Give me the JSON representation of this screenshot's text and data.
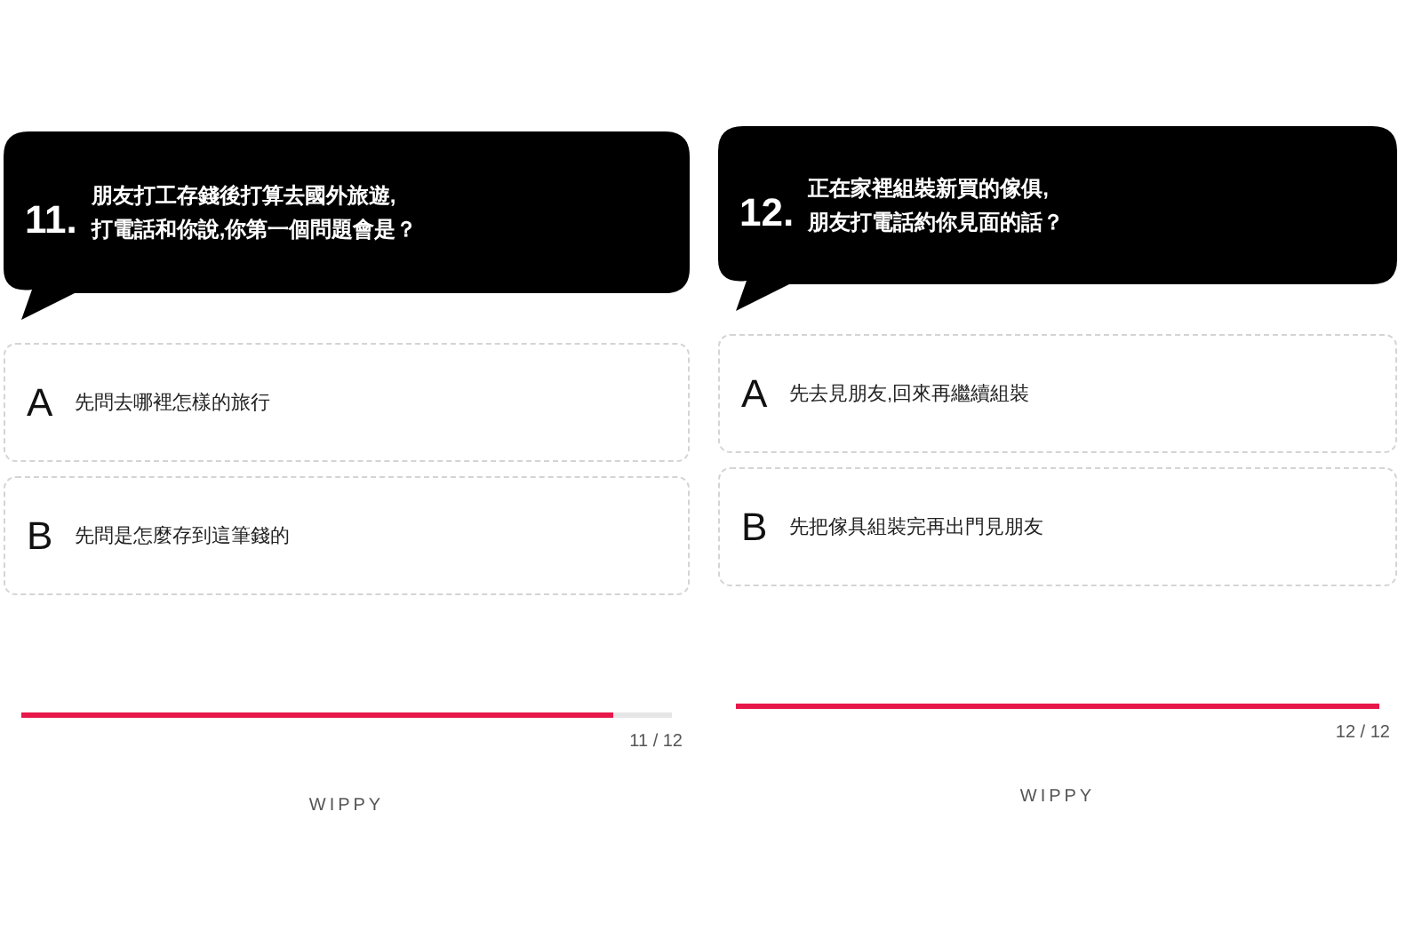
{
  "panels": [
    {
      "number": "11.",
      "question": "朋友打工存錢後打算去國外旅遊,\n打電話和你說,你第一個問題會是？",
      "options": [
        {
          "letter": "A",
          "text": "先問去哪裡怎樣的旅行"
        },
        {
          "letter": "B",
          "text": "先問是怎麼存到這筆錢的"
        }
      ],
      "progress": {
        "level": 0.91,
        "counter": "11 / 12"
      },
      "brand": "WIPPY"
    },
    {
      "number": "12.",
      "question": "正在家裡組裝新買的傢俱,\n朋友打電話約你見面的話？",
      "options": [
        {
          "letter": "A",
          "text": "先去見朋友,回來再繼續組裝"
        },
        {
          "letter": "B",
          "text": "先把傢具組裝完再出門見朋友"
        }
      ],
      "progress": {
        "level": 1,
        "counter": "12 / 12"
      },
      "brand": "WIPPY"
    }
  ]
}
